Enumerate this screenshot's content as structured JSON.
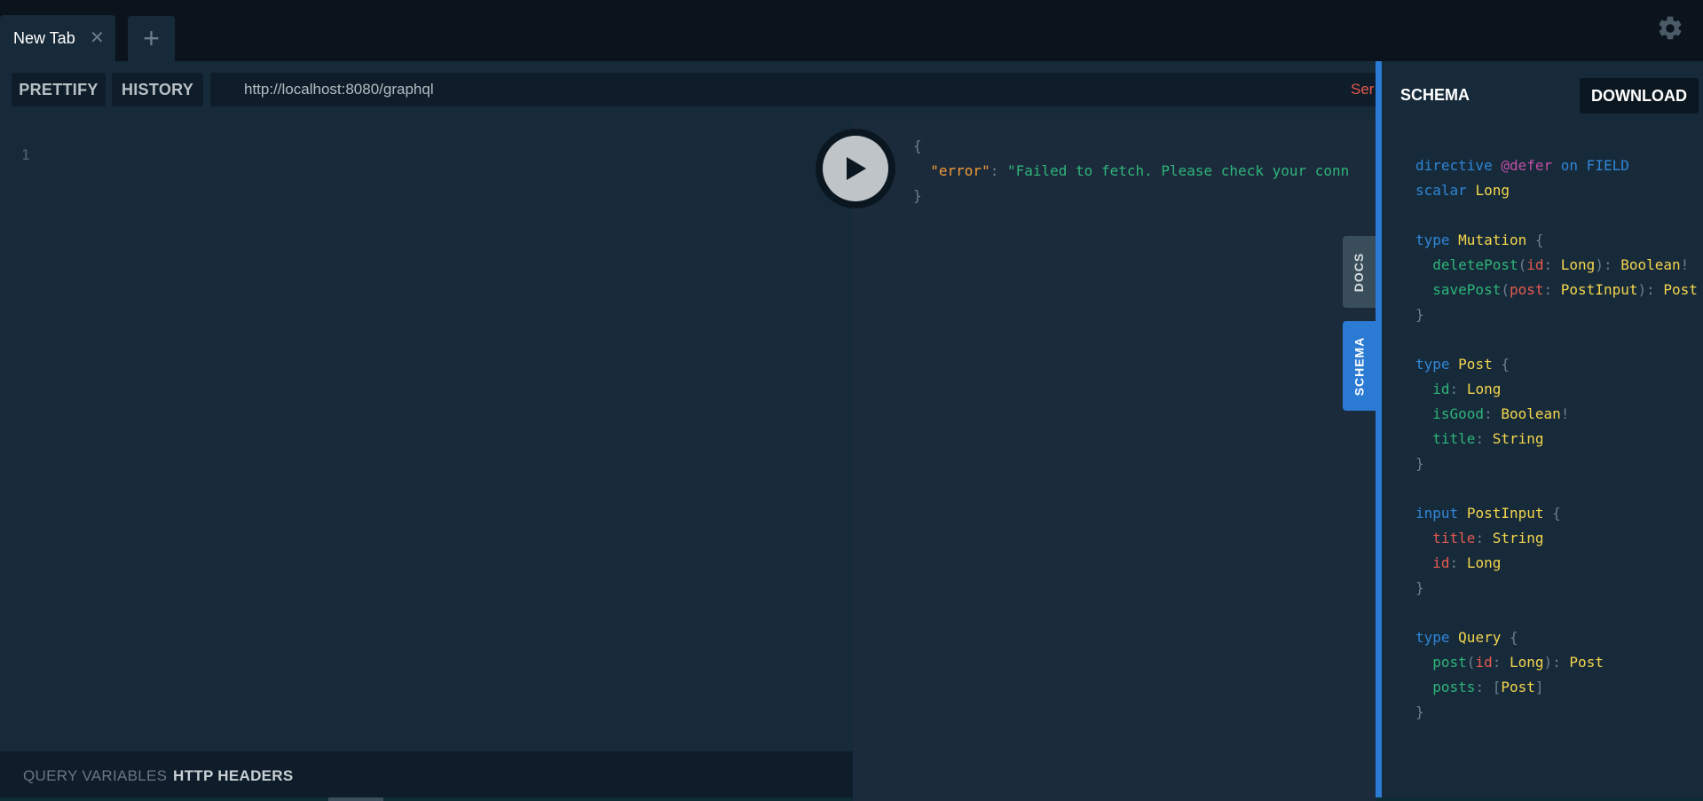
{
  "tabs": {
    "active_title": "New Tab",
    "close_glyph": "✕",
    "add_glyph": "+"
  },
  "toolbar": {
    "prettify_label": "PRETTIFY",
    "history_label": "HISTORY",
    "endpoint_url": "http://localhost:8080/graphql",
    "endpoint_status": "Ser"
  },
  "editor": {
    "line_number": "1"
  },
  "bottom": {
    "query_variables_label": "QUERY VARIABLES",
    "http_headers_label": "HTTP HEADERS"
  },
  "result": {
    "open_brace": "{",
    "error_key": "\"error\"",
    "error_value": "\"Failed to fetch. Please check your conn",
    "close_brace": "}"
  },
  "side_tabs": {
    "docs_label": "DOCS",
    "schema_label": "SCHEMA"
  },
  "schema_panel": {
    "title": "SCHEMA",
    "download_label": "DOWNLOAD"
  },
  "schema_sdl": [
    "directive @defer on FIELD",
    "scalar Long",
    "",
    "type Mutation {",
    "  deletePost(id: Long): Boolean!",
    "  savePost(post: PostInput): Post",
    "}",
    "",
    "type Post {",
    "  id: Long",
    "  isGood: Boolean!",
    "  title: String",
    "}",
    "",
    "input PostInput {",
    "  title: String",
    "  id: Long",
    "}",
    "",
    "type Query {",
    "  post(id: Long): Post",
    "  posts: [Post]",
    "}"
  ],
  "icons": {
    "settings": "gear-icon",
    "run": "play-icon"
  },
  "colors": {
    "accent": "#2b7bd4",
    "error": "#e2584c",
    "background": "#172a3a",
    "result_bg": "#1b2b3b"
  }
}
